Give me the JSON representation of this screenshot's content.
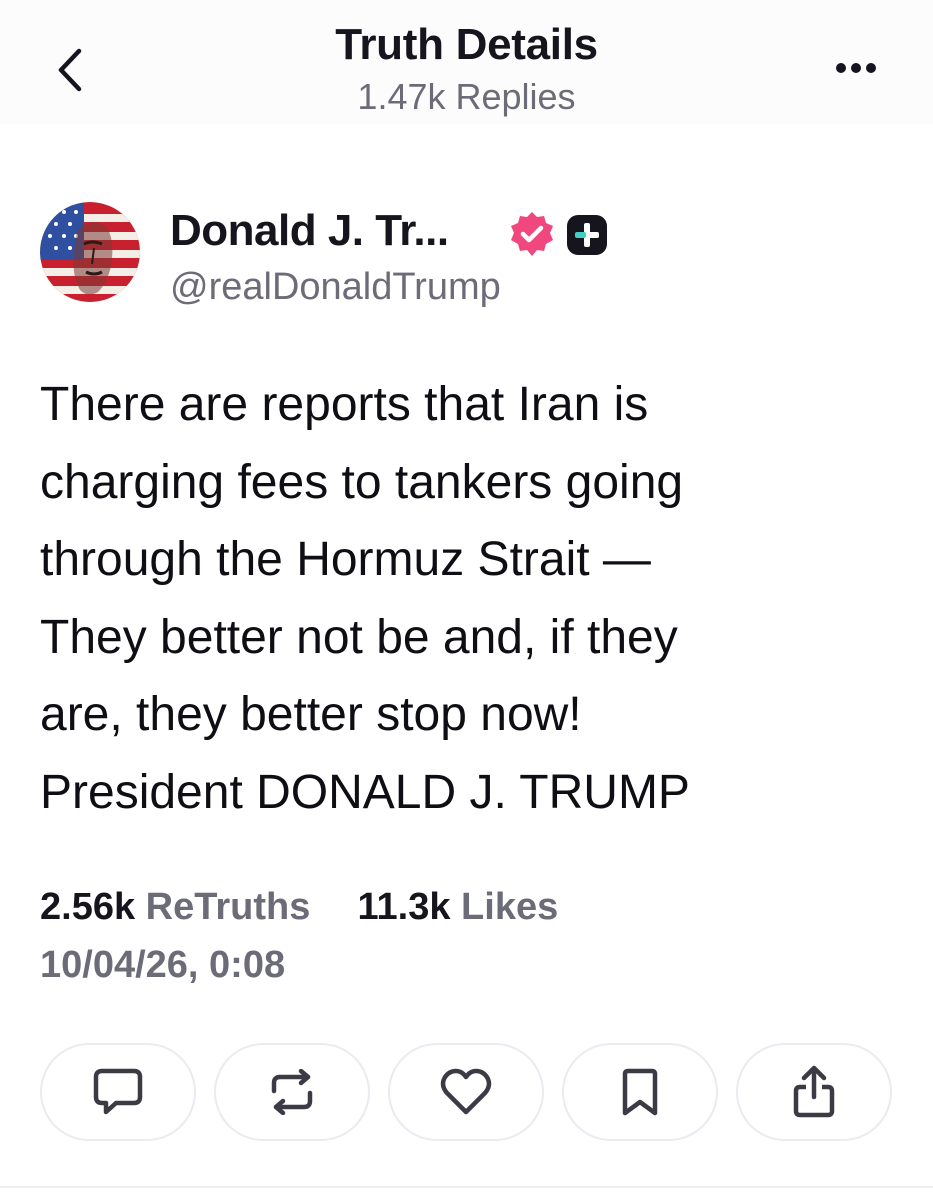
{
  "header": {
    "title": "Truth Details",
    "subtitle": "1.47k Replies",
    "back_icon": "chevron-left-icon",
    "more_icon": "more-horizontal-icon"
  },
  "post": {
    "author": {
      "name": "Donald J. Tr...",
      "handle": "@realDonaldTrump",
      "avatar_icon": "user-avatar",
      "verified_icon": "verified-badge-icon",
      "verified_color": "#f0477f",
      "plus_icon": "plus-badge-icon"
    },
    "body_lines": [
      "There are reports that Iran is",
      "charging fees to tankers going",
      "through the Hormuz Strait —",
      "They better not be and, if they",
      "are, they better stop now!",
      "President DONALD J. TRUMP"
    ],
    "stats": {
      "retruths_count": "2.56k",
      "retruths_label": "ReTruths",
      "likes_count": "11.3k",
      "likes_label": "Likes"
    },
    "timestamp": "10/04/26, 0:08"
  },
  "actions": [
    {
      "name": "reply",
      "icon": "comment-icon"
    },
    {
      "name": "retruth",
      "icon": "repost-icon"
    },
    {
      "name": "like",
      "icon": "heart-icon"
    },
    {
      "name": "bookmark",
      "icon": "bookmark-icon"
    },
    {
      "name": "share",
      "icon": "share-icon"
    }
  ],
  "colors": {
    "text_primary": "#16151d",
    "text_muted": "#6c6b78",
    "icon_color": "#3c3b45",
    "border": "#eceaf0"
  }
}
